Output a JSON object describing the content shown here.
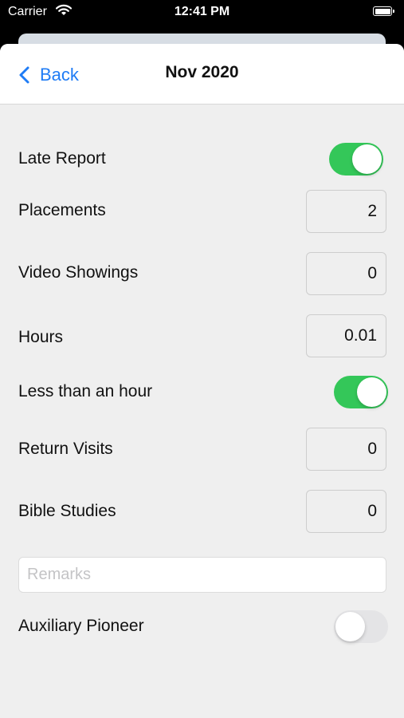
{
  "status": {
    "carrier": "Carrier",
    "time": "12:41 PM"
  },
  "nav": {
    "back_label": "Back",
    "title": "Nov 2020"
  },
  "form": {
    "late_report": {
      "label": "Late Report",
      "on": true
    },
    "placements": {
      "label": "Placements",
      "value": "2"
    },
    "video_showings": {
      "label": "Video Showings",
      "value": "0"
    },
    "hours": {
      "label": "Hours",
      "value": "0.01"
    },
    "less_than_hour": {
      "label": "Less than an hour",
      "on": true
    },
    "return_visits": {
      "label": "Return Visits",
      "value": "0"
    },
    "bible_studies": {
      "label": "Bible Studies",
      "value": "0"
    },
    "remarks": {
      "placeholder": "Remarks",
      "value": ""
    },
    "auxiliary_pioneer": {
      "label": "Auxiliary Pioneer",
      "on": false
    }
  },
  "colors": {
    "accent": "#1f7cf5",
    "toggle_on": "#34c759",
    "toggle_off": "#e4e4e6"
  }
}
